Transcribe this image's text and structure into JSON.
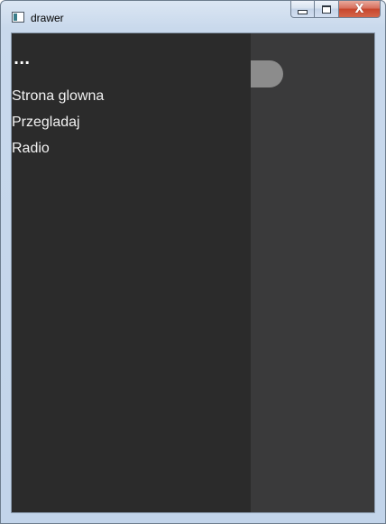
{
  "window": {
    "title": "drawer",
    "app_icon": "window-app-icon",
    "caption": {
      "minimize_icon": "minimize-icon",
      "maximize_icon": "maximize-icon",
      "close_glyph": "X"
    }
  },
  "drawer": {
    "menu_icon_glyph": "...",
    "items": [
      {
        "label": "Strona glowna"
      },
      {
        "label": "Przegladaj"
      },
      {
        "label": "Radio"
      }
    ]
  },
  "colors": {
    "drawer_bg": "#2b2b2b",
    "content_bg": "#3a3a3b",
    "handle": "#8c8c8c",
    "text": "#f2f2f2"
  }
}
